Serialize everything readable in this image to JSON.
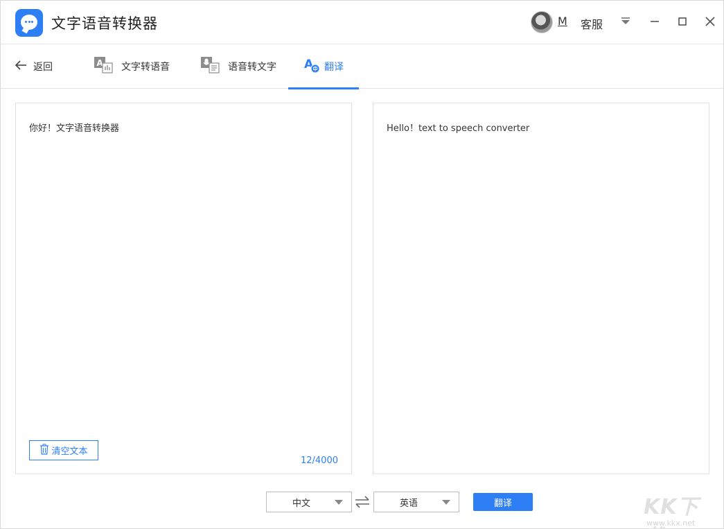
{
  "app": {
    "title": "文字语音转换器",
    "accent_color": "#2e7ef5"
  },
  "titlebar": {
    "user_name": "M",
    "service_label": "客服",
    "icons": [
      "dropdown-icon",
      "minimize-icon",
      "maximize-icon",
      "close-icon"
    ]
  },
  "tabs": {
    "back_label": "返回",
    "items": [
      {
        "label": "文字转语音",
        "icon": "text-to-speech-icon",
        "active": false
      },
      {
        "label": "语音转文字",
        "icon": "speech-to-text-icon",
        "active": false
      },
      {
        "label": "翻译",
        "icon": "translate-icon",
        "active": true
      }
    ]
  },
  "source_panel": {
    "text": "你好！文字语音转换器",
    "clear_label": "清空文本",
    "counter": "12/4000"
  },
  "result_panel": {
    "text": "Hello！text to speech converter"
  },
  "controls": {
    "source_language": "中文",
    "target_language": "英语",
    "translate_label": "翻译"
  },
  "watermark": {
    "text": "KK下载",
    "url": "www.kkx.net"
  }
}
